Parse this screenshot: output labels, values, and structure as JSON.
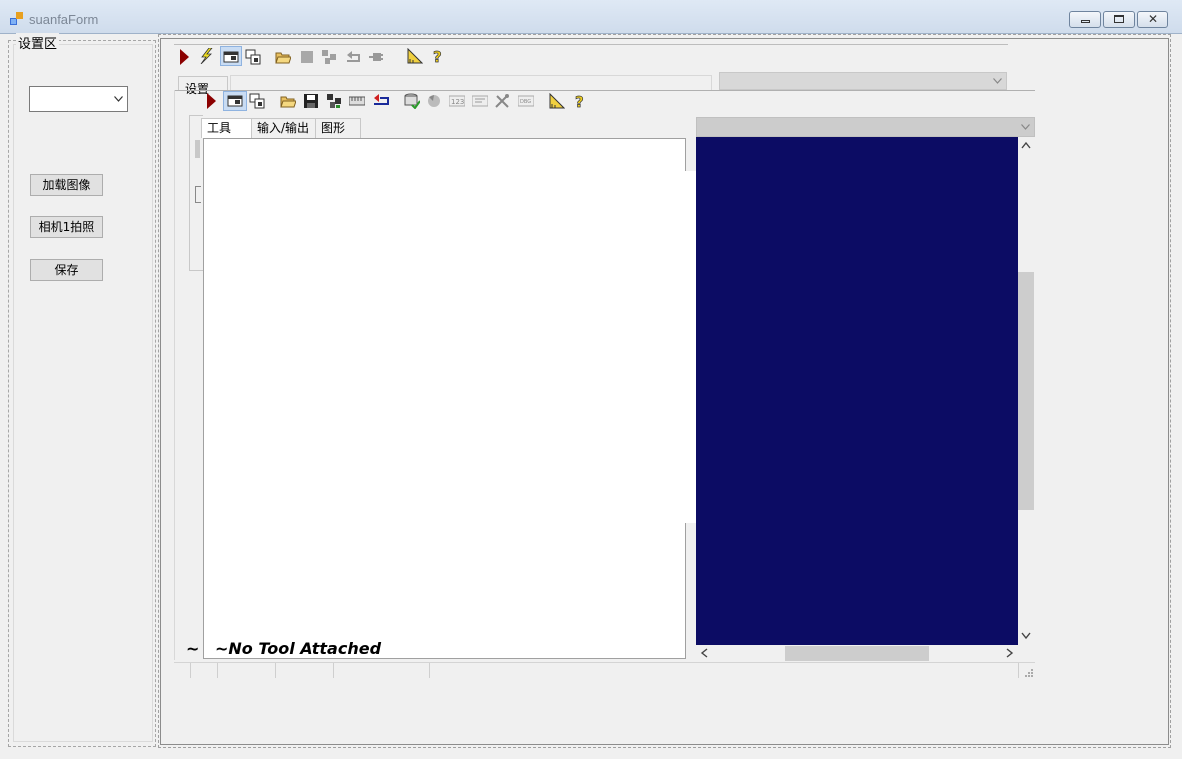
{
  "window": {
    "title": "suanfaForm",
    "minimize_icon": "minimize-icon",
    "maximize_icon": "maximize-icon",
    "close_icon": "close-icon"
  },
  "left_panel": {
    "group_title": "设置区",
    "combo_value": "",
    "buttons": [
      "加载图像",
      "相机1拍照",
      "保存"
    ]
  },
  "right_panel": {
    "top_toolbar_icons": [
      "run-icon",
      "lightning-icon",
      "window-icon",
      "copy-window-icon",
      "open-folder-icon",
      "stop-icon",
      "grid-icon",
      "reset-icon",
      "plug-icon",
      "measure-icon",
      "help-icon"
    ],
    "tab_label": "设置",
    "inner_toolbar_icons": [
      "run-icon",
      "window-icon",
      "copy-window-icon",
      "open-folder-icon",
      "save-icon",
      "grid-icon",
      "ruler-icon",
      "import-icon",
      "database-icon",
      "undo-icon",
      "numeric-icon",
      "list-icon",
      "tools-icon",
      "debug-icon",
      "measure-icon",
      "help-icon"
    ],
    "tool_tabs": [
      "工具",
      "输入/输出",
      "图形"
    ],
    "no_tool_text": "~No Tool Attached",
    "tilde": "~"
  },
  "colors": {
    "display_background": "#0c0c64",
    "run_icon": "#8b0000"
  }
}
